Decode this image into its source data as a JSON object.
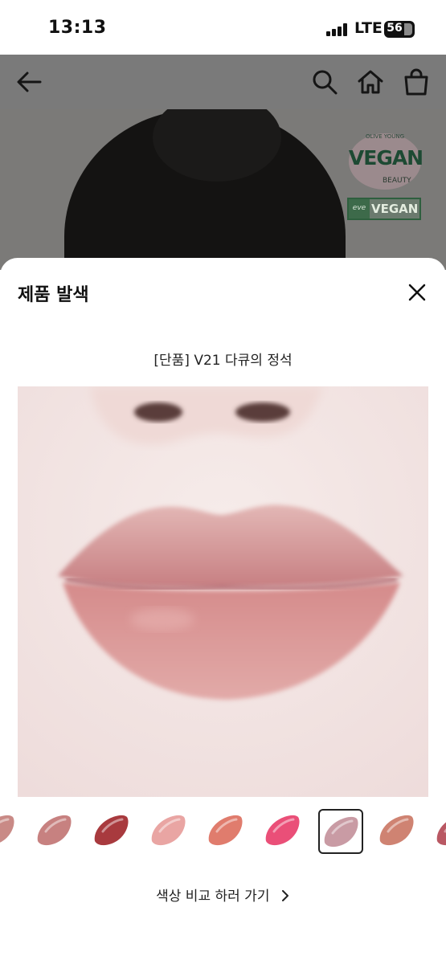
{
  "status_bar": {
    "time": "13:13",
    "network": "LTE",
    "battery": "56"
  },
  "nav": {
    "back_icon": "arrow-left-icon",
    "search_icon": "search-icon",
    "home_icon": "home-icon",
    "cart_icon": "shopping-bag-icon"
  },
  "hero": {
    "badge_1": {
      "top": "OLIVE YOUNG",
      "main": "VEGAN",
      "bottom": "BEAUTY"
    },
    "badge_2": {
      "logo": "eve",
      "main": "VEGAN"
    }
  },
  "sheet": {
    "title": "제품 발색",
    "close_icon": "close-icon",
    "product_name": "[단품] V21 다큐의 정석",
    "compare_label": "색상 비교 하러 가기",
    "compare_icon": "chevron-right-icon"
  },
  "swatches": {
    "colors": [
      "#c98a86",
      "#c78180",
      "#a83a3e",
      "#e9a5a3",
      "#e07c6d",
      "#ea4f78",
      "#c99ba4",
      "#cf8372",
      "#b95863"
    ],
    "selected_index": 6
  },
  "colors": {
    "overlay": "#7a7a7a",
    "lip": "#d38e90",
    "skin": "#f3e7e6"
  }
}
